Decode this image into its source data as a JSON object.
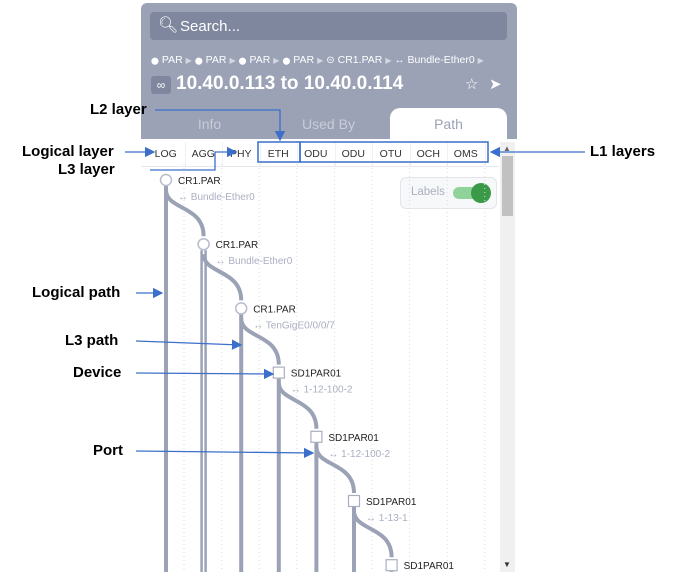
{
  "search": {
    "placeholder": "Search...",
    "icon": "search-icon"
  },
  "breadcrumbs": [
    {
      "icon": "location-pin-icon",
      "label": "PAR"
    },
    {
      "icon": "location-pin-icon",
      "label": "PAR"
    },
    {
      "icon": "location-pin-icon",
      "label": "PAR"
    },
    {
      "icon": "location-pin-icon",
      "label": "PAR"
    },
    {
      "icon": "device-icon",
      "label": "CR1.PAR"
    },
    {
      "icon": "port-icon",
      "label": "Bundle-Ether0"
    }
  ],
  "title": "10.40.0.113 to 10.40.0.114",
  "tabs": [
    {
      "label": "Info"
    },
    {
      "label": "Used By"
    },
    {
      "label": "Path",
      "active": true
    }
  ],
  "layers": [
    "LOG",
    "AGG",
    "PHY",
    "ETH",
    "ODU",
    "ODU",
    "OTU",
    "OCH",
    "OMS"
  ],
  "labels_toggle": {
    "label": "Labels",
    "on": true
  },
  "nodes": [
    {
      "name": "CR1.PAR",
      "port": "Bundle-Ether0",
      "shape": "circle"
    },
    {
      "name": "CR1.PAR",
      "port": "Bundle-Ether0",
      "shape": "circle"
    },
    {
      "name": "CR1.PAR",
      "port": "TenGigE0/0/0/7",
      "shape": "circle"
    },
    {
      "name": "SD1PAR01",
      "port": "1-12-100-2",
      "shape": "square"
    },
    {
      "name": "SD1PAR01",
      "port": "1-12-100-2",
      "shape": "square"
    },
    {
      "name": "SD1PAR01",
      "port": "1-13-1",
      "shape": "square"
    },
    {
      "name": "SD1PAR01",
      "port": "",
      "shape": "square"
    }
  ],
  "annotations": {
    "l2_layer": "L2 layer",
    "logical_layer": "Logical layer",
    "l3_layer": "L3 layer",
    "l1_layers": "L1 layers",
    "logical_path": "Logical path",
    "l3_path": "L3 path",
    "device": "Device",
    "port": "Port"
  },
  "colors": {
    "header": "#9ba2b5",
    "annotation": "#3b6fc9",
    "path": "#9ba2b5",
    "toggle": "#3a9a48"
  }
}
